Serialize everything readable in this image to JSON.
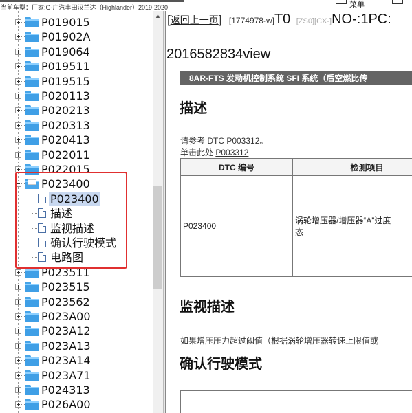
{
  "topbar": {
    "car_info": "当前车型：厂家:G-广汽丰田汉兰达（Highlander）2019-2020",
    "favorites_label": "菜单"
  },
  "tree": {
    "items_before": [
      "P019015",
      "P01902A",
      "P019064",
      "P019511",
      "P019515",
      "P020113",
      "P020213",
      "P020313",
      "P020413",
      "P022011",
      "P022015"
    ],
    "expanded": {
      "label": "P023400",
      "children": [
        "P023400",
        "描述",
        "监视描述",
        "确认行驶模式",
        "电路图"
      ],
      "selected_child": "P023400"
    },
    "items_after": [
      "P023511",
      "P023515",
      "P023562",
      "P023A00",
      "P023A12",
      "P023A13",
      "P023A14",
      "P023A71",
      "P024313",
      "P026A00"
    ]
  },
  "content": {
    "back_link": "返回上一页",
    "doc_code": "[1774978-w]",
    "t0": "T0",
    "zs": "[ZS0][CX-]",
    "no": "NO-:1PC:",
    "view_id": "2016582834view",
    "banner": "8AR-FTS 发动机控制系统  SFI 系统（后空燃比传",
    "heading_desc": "描述",
    "refer_text": "请参考 DTC P003312。",
    "click_prefix": "单击此处",
    "click_link": "P003312",
    "table": {
      "headers": [
        "DTC 编号",
        "检测项目"
      ],
      "rows": [
        [
          "P023400",
          "涡轮增压器/增压器“A”过度\n态"
        ]
      ]
    },
    "heading_monitor": "监视描述",
    "monitor_text": "如果增压压力超过阈值（根据涡轮增压器转速上限值或",
    "heading_confirm": "确认行驶模式"
  }
}
